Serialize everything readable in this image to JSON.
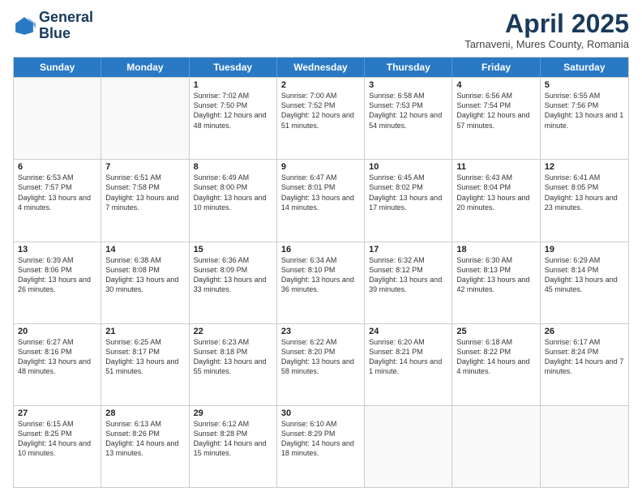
{
  "header": {
    "logo_line1": "General",
    "logo_line2": "Blue",
    "title": "April 2025",
    "location": "Tarnaveni, Mures County, Romania"
  },
  "weekdays": [
    "Sunday",
    "Monday",
    "Tuesday",
    "Wednesday",
    "Thursday",
    "Friday",
    "Saturday"
  ],
  "weeks": [
    [
      {
        "day": "",
        "info": ""
      },
      {
        "day": "",
        "info": ""
      },
      {
        "day": "1",
        "info": "Sunrise: 7:02 AM\nSunset: 7:50 PM\nDaylight: 12 hours and 48 minutes."
      },
      {
        "day": "2",
        "info": "Sunrise: 7:00 AM\nSunset: 7:52 PM\nDaylight: 12 hours and 51 minutes."
      },
      {
        "day": "3",
        "info": "Sunrise: 6:58 AM\nSunset: 7:53 PM\nDaylight: 12 hours and 54 minutes."
      },
      {
        "day": "4",
        "info": "Sunrise: 6:56 AM\nSunset: 7:54 PM\nDaylight: 12 hours and 57 minutes."
      },
      {
        "day": "5",
        "info": "Sunrise: 6:55 AM\nSunset: 7:56 PM\nDaylight: 13 hours and 1 minute."
      }
    ],
    [
      {
        "day": "6",
        "info": "Sunrise: 6:53 AM\nSunset: 7:57 PM\nDaylight: 13 hours and 4 minutes."
      },
      {
        "day": "7",
        "info": "Sunrise: 6:51 AM\nSunset: 7:58 PM\nDaylight: 13 hours and 7 minutes."
      },
      {
        "day": "8",
        "info": "Sunrise: 6:49 AM\nSunset: 8:00 PM\nDaylight: 13 hours and 10 minutes."
      },
      {
        "day": "9",
        "info": "Sunrise: 6:47 AM\nSunset: 8:01 PM\nDaylight: 13 hours and 14 minutes."
      },
      {
        "day": "10",
        "info": "Sunrise: 6:45 AM\nSunset: 8:02 PM\nDaylight: 13 hours and 17 minutes."
      },
      {
        "day": "11",
        "info": "Sunrise: 6:43 AM\nSunset: 8:04 PM\nDaylight: 13 hours and 20 minutes."
      },
      {
        "day": "12",
        "info": "Sunrise: 6:41 AM\nSunset: 8:05 PM\nDaylight: 13 hours and 23 minutes."
      }
    ],
    [
      {
        "day": "13",
        "info": "Sunrise: 6:39 AM\nSunset: 8:06 PM\nDaylight: 13 hours and 26 minutes."
      },
      {
        "day": "14",
        "info": "Sunrise: 6:38 AM\nSunset: 8:08 PM\nDaylight: 13 hours and 30 minutes."
      },
      {
        "day": "15",
        "info": "Sunrise: 6:36 AM\nSunset: 8:09 PM\nDaylight: 13 hours and 33 minutes."
      },
      {
        "day": "16",
        "info": "Sunrise: 6:34 AM\nSunset: 8:10 PM\nDaylight: 13 hours and 36 minutes."
      },
      {
        "day": "17",
        "info": "Sunrise: 6:32 AM\nSunset: 8:12 PM\nDaylight: 13 hours and 39 minutes."
      },
      {
        "day": "18",
        "info": "Sunrise: 6:30 AM\nSunset: 8:13 PM\nDaylight: 13 hours and 42 minutes."
      },
      {
        "day": "19",
        "info": "Sunrise: 6:29 AM\nSunset: 8:14 PM\nDaylight: 13 hours and 45 minutes."
      }
    ],
    [
      {
        "day": "20",
        "info": "Sunrise: 6:27 AM\nSunset: 8:16 PM\nDaylight: 13 hours and 48 minutes."
      },
      {
        "day": "21",
        "info": "Sunrise: 6:25 AM\nSunset: 8:17 PM\nDaylight: 13 hours and 51 minutes."
      },
      {
        "day": "22",
        "info": "Sunrise: 6:23 AM\nSunset: 8:18 PM\nDaylight: 13 hours and 55 minutes."
      },
      {
        "day": "23",
        "info": "Sunrise: 6:22 AM\nSunset: 8:20 PM\nDaylight: 13 hours and 58 minutes."
      },
      {
        "day": "24",
        "info": "Sunrise: 6:20 AM\nSunset: 8:21 PM\nDaylight: 14 hours and 1 minute."
      },
      {
        "day": "25",
        "info": "Sunrise: 6:18 AM\nSunset: 8:22 PM\nDaylight: 14 hours and 4 minutes."
      },
      {
        "day": "26",
        "info": "Sunrise: 6:17 AM\nSunset: 8:24 PM\nDaylight: 14 hours and 7 minutes."
      }
    ],
    [
      {
        "day": "27",
        "info": "Sunrise: 6:15 AM\nSunset: 8:25 PM\nDaylight: 14 hours and 10 minutes."
      },
      {
        "day": "28",
        "info": "Sunrise: 6:13 AM\nSunset: 8:26 PM\nDaylight: 14 hours and 13 minutes."
      },
      {
        "day": "29",
        "info": "Sunrise: 6:12 AM\nSunset: 8:28 PM\nDaylight: 14 hours and 15 minutes."
      },
      {
        "day": "30",
        "info": "Sunrise: 6:10 AM\nSunset: 8:29 PM\nDaylight: 14 hours and 18 minutes."
      },
      {
        "day": "",
        "info": ""
      },
      {
        "day": "",
        "info": ""
      },
      {
        "day": "",
        "info": ""
      }
    ]
  ]
}
